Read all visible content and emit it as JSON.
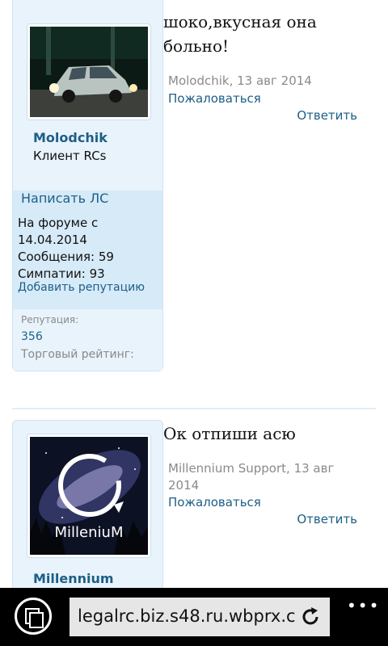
{
  "posts": [
    {
      "username": "Molodchik",
      "user_title": "Клиент RCs",
      "pm_label": "Написать ЛС",
      "forum_since_label": "На форуме с",
      "forum_since_date": "14.04.2014",
      "messages": "Сообщения: 59",
      "likes": "Симпатии: 93",
      "add_rep": "Добавить репутацию",
      "rep_label": "Репутация:",
      "rep_value": "356",
      "trade_label": "Торговый рейтинг:",
      "message_lines": [
        "шоко,вкусная она",
        "больно!"
      ],
      "meta": "Molodchik, 13 авг 2014",
      "report": "Пожаловаться",
      "reply": "Ответить"
    },
    {
      "username": "Millennium",
      "message_lines": [
        "Ок отпиши асю"
      ],
      "meta": "Millennium Support, 13 авг 2014",
      "report": "Пожаловаться",
      "reply": "Ответить",
      "avatar_text": "MilleniuM"
    }
  ],
  "browser": {
    "url": "legalrc.biz.s48.ru.wbprx.c",
    "more": "•••"
  },
  "colors": {
    "link": "#1d5f86",
    "card_bg": "#e8f3fb",
    "extra_bg": "#d6eaf8",
    "bar_bg": "#000000"
  }
}
